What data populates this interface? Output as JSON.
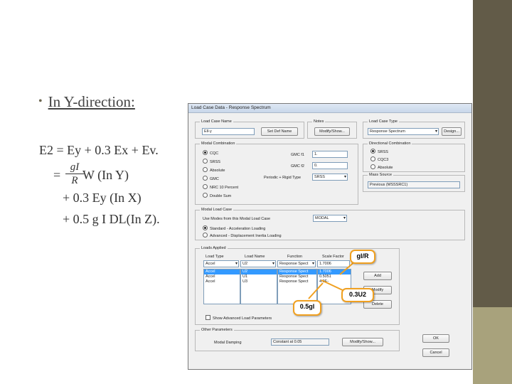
{
  "slide": {
    "bullet": "In Y-direction:",
    "eq_line1": "E2 = Ey + 0.3 Ex + Ev.",
    "eq_prefix": "=",
    "frac_num": "gI",
    "frac_den": "R",
    "eq_line2_rest": "W (In Y)",
    "eq_line3": "+ 0.3 Ey (In X)",
    "eq_line4": "+ 0.5 g I DL(In Z).",
    "colors": {
      "sidebar": "#625b48",
      "sidebar_bottom": "#a8a27c",
      "callout_border": "#f0a020"
    }
  },
  "dialog": {
    "title": "Load Case Data - Response Spectrum",
    "load_case_name": {
      "label": "Load Case Name",
      "value": "Ell-y",
      "button": "Set Def Name"
    },
    "notes": {
      "label": "Notes",
      "button": "Modify/Show..."
    },
    "load_case_type": {
      "label": "Load Case Type",
      "value": "Response Spectrum",
      "button": "Design..."
    },
    "modal_combination": {
      "label": "Modal Combination",
      "options": [
        "CQC",
        "SRSS",
        "Absolute",
        "GMC",
        "NRC 10 Percent",
        "Double Sum"
      ],
      "selected": 0,
      "gmc_f1_label": "GMC f1",
      "gmc_f1_value": "1.",
      "gmc_f2_label": "GMC f2",
      "gmc_f2_value": "0.",
      "periodic_label": "Periodic + Rigid Type",
      "periodic_value": "SRSS"
    },
    "directional_combination": {
      "label": "Directional Combination",
      "options": [
        "SRSS",
        "CQC3",
        "Absolute"
      ],
      "selected": 0
    },
    "mass_source": {
      "label": "Mass Source",
      "value": "Previous (MSSSRC1)"
    },
    "modal_load_case": {
      "label": "Modal Load Case",
      "prompt": "Use Modes from this Modal Load Case",
      "value": "MODAL",
      "options": [
        "Standard - Acceleration Loading",
        "Advanced - Displacement Inertia Loading"
      ],
      "selected": 0
    },
    "loads_applied": {
      "label": "Loads Applied",
      "headers": [
        "Load Type",
        "Load Name",
        "Function",
        "Scale Factor"
      ],
      "entry": [
        "Accel",
        "U2",
        "Response Spect",
        "1.7006"
      ],
      "rows": [
        [
          "Accel",
          "U2",
          "Response Spect",
          "1.7006"
        ],
        [
          "Accel",
          "U1",
          "Response Spect",
          "0.5051"
        ],
        [
          "Accel",
          "U3",
          "Response Spect",
          "4.9E-"
        ]
      ],
      "buttons": [
        "Add",
        "Modify",
        "Delete"
      ],
      "advanced_check": "Show Advanced Load Parameters"
    },
    "other_parameters": {
      "label": "Other Parameters",
      "damping_label": "Modal Damping",
      "damping_value": "Constant at 0.05",
      "button": "Modify/Show..."
    },
    "ok": "OK",
    "cancel": "Cancel"
  },
  "callouts": {
    "gl_over_r": "gl/R",
    "u2": "0.3U2",
    "gl": "0.5gl"
  }
}
